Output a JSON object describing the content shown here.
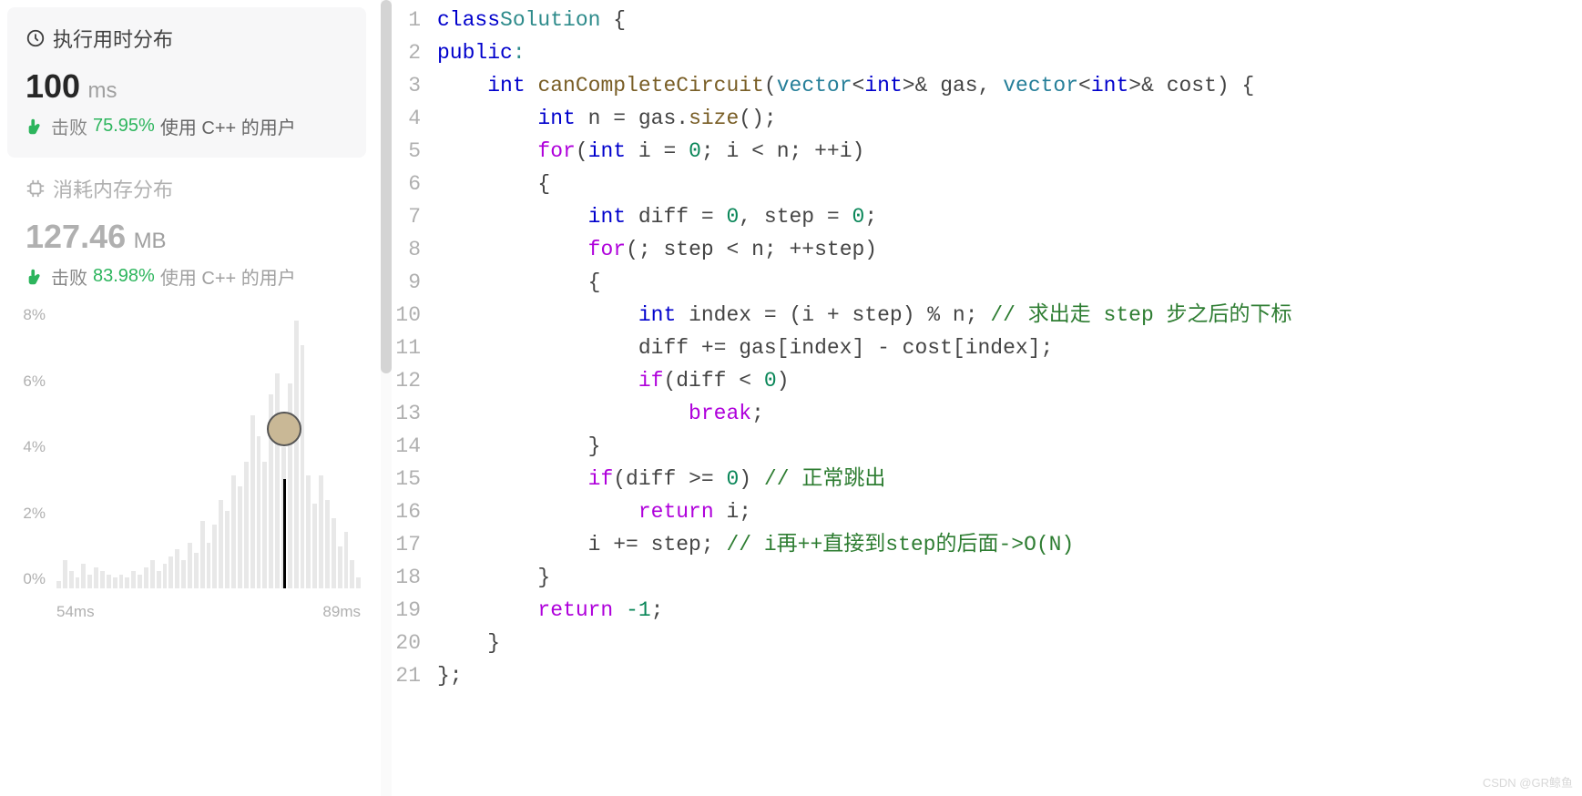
{
  "runtime": {
    "header": "执行用时分布",
    "value": "100",
    "unit": "ms",
    "beats_label": "击败",
    "beats_percent": "75.95%",
    "beats_suffix": "使用 C++ 的用户"
  },
  "memory": {
    "header": "消耗内存分布",
    "value": "127.46",
    "unit": "MB",
    "beats_label": "击败",
    "beats_percent": "83.98%",
    "beats_suffix": "使用 C++ 的用户"
  },
  "chart_data": {
    "type": "bar",
    "x_unit": "ms",
    "x_ticks": [
      "54ms",
      "89ms"
    ],
    "y_ticks": [
      "8%",
      "6%",
      "4%",
      "2%",
      "0%"
    ],
    "ylim": [
      0,
      8
    ],
    "marker_value": 100,
    "values": [
      0.2,
      0.8,
      0.5,
      0.3,
      0.7,
      0.4,
      0.6,
      0.5,
      0.4,
      0.3,
      0.4,
      0.3,
      0.5,
      0.4,
      0.6,
      0.8,
      0.5,
      0.7,
      0.9,
      1.1,
      0.8,
      1.3,
      1.0,
      1.9,
      1.3,
      1.8,
      2.5,
      2.2,
      3.2,
      2.9,
      3.6,
      4.9,
      4.3,
      3.6,
      5.5,
      6.1,
      4.0,
      5.8,
      7.6,
      6.9,
      3.2,
      2.4,
      3.2,
      2.5,
      2.0,
      1.2,
      1.6,
      0.8,
      0.3
    ],
    "marker_index": 36
  },
  "code_lines": [
    {
      "n": "1",
      "tokens": [
        [
          "kw",
          "class"
        ],
        [
          "",
          ""
        ],
        [
          "cls",
          "Solution"
        ],
        [
          "",
          " {"
        ]
      ]
    },
    {
      "n": "2",
      "tokens": [
        [
          "kw",
          "public"
        ],
        [
          "cls",
          ":"
        ]
      ]
    },
    {
      "n": "3",
      "tokens": [
        [
          "",
          "    "
        ],
        [
          "kw",
          "int"
        ],
        [
          "",
          " "
        ],
        [
          "fn",
          "canCompleteCircuit"
        ],
        [
          "",
          "("
        ],
        [
          "type",
          "vector"
        ],
        [
          "op",
          "<"
        ],
        [
          "kw",
          "int"
        ],
        [
          "op",
          ">&"
        ],
        [
          "",
          " gas, "
        ],
        [
          "type",
          "vector"
        ],
        [
          "op",
          "<"
        ],
        [
          "kw",
          "int"
        ],
        [
          "op",
          ">&"
        ],
        [
          "",
          " cost) {"
        ]
      ]
    },
    {
      "n": "4",
      "tokens": [
        [
          "",
          "        "
        ],
        [
          "kw",
          "int"
        ],
        [
          "",
          " n = gas."
        ],
        [
          "fn",
          "size"
        ],
        [
          "",
          "();"
        ]
      ]
    },
    {
      "n": "5",
      "tokens": [
        [
          "",
          "        "
        ],
        [
          "ret",
          "for"
        ],
        [
          "",
          "("
        ],
        [
          "kw",
          "int"
        ],
        [
          "",
          " i = "
        ],
        [
          "num",
          "0"
        ],
        [
          "",
          "; i < n; ++i)"
        ]
      ]
    },
    {
      "n": "6",
      "tokens": [
        [
          "",
          "        {"
        ]
      ]
    },
    {
      "n": "7",
      "tokens": [
        [
          "",
          "            "
        ],
        [
          "kw",
          "int"
        ],
        [
          "",
          " diff = "
        ],
        [
          "num",
          "0"
        ],
        [
          "",
          ", step = "
        ],
        [
          "num",
          "0"
        ],
        [
          "",
          ";"
        ]
      ]
    },
    {
      "n": "8",
      "tokens": [
        [
          "",
          "            "
        ],
        [
          "ret",
          "for"
        ],
        [
          "",
          "(; step < n; ++step)"
        ]
      ]
    },
    {
      "n": "9",
      "tokens": [
        [
          "",
          "            {"
        ]
      ]
    },
    {
      "n": "10",
      "tokens": [
        [
          "",
          "                "
        ],
        [
          "kw",
          "int"
        ],
        [
          "",
          " index = (i + step) % n; "
        ],
        [
          "cm",
          "// 求出走 step 步之后的下标"
        ]
      ]
    },
    {
      "n": "11",
      "tokens": [
        [
          "",
          "                diff += gas[index] - cost[index];"
        ]
      ]
    },
    {
      "n": "12",
      "tokens": [
        [
          "",
          "                "
        ],
        [
          "ret",
          "if"
        ],
        [
          "",
          "(diff < "
        ],
        [
          "num",
          "0"
        ],
        [
          "",
          ")"
        ]
      ]
    },
    {
      "n": "13",
      "tokens": [
        [
          "",
          "                    "
        ],
        [
          "ret",
          "break"
        ],
        [
          "",
          ";"
        ]
      ]
    },
    {
      "n": "14",
      "tokens": [
        [
          "",
          "            }"
        ]
      ]
    },
    {
      "n": "15",
      "tokens": [
        [
          "",
          "            "
        ],
        [
          "ret",
          "if"
        ],
        [
          "",
          "(diff >= "
        ],
        [
          "num",
          "0"
        ],
        [
          "",
          ") "
        ],
        [
          "cm",
          "// 正常跳出"
        ]
      ]
    },
    {
      "n": "16",
      "tokens": [
        [
          "",
          "                "
        ],
        [
          "ret",
          "return"
        ],
        [
          "",
          " i;"
        ]
      ]
    },
    {
      "n": "17",
      "tokens": [
        [
          "",
          "            i += step; "
        ],
        [
          "cm",
          "// i再++直接到step的后面->O(N)"
        ]
      ]
    },
    {
      "n": "18",
      "tokens": [
        [
          "",
          "        }"
        ]
      ]
    },
    {
      "n": "19",
      "tokens": [
        [
          "",
          "        "
        ],
        [
          "ret",
          "return"
        ],
        [
          "",
          " "
        ],
        [
          "num",
          "-1"
        ],
        [
          "",
          ";"
        ]
      ]
    },
    {
      "n": "20",
      "tokens": [
        [
          "",
          "    }"
        ]
      ]
    },
    {
      "n": "21",
      "tokens": [
        [
          "",
          "};"
        ]
      ]
    }
  ],
  "watermark": "CSDN @GR鲸鱼"
}
